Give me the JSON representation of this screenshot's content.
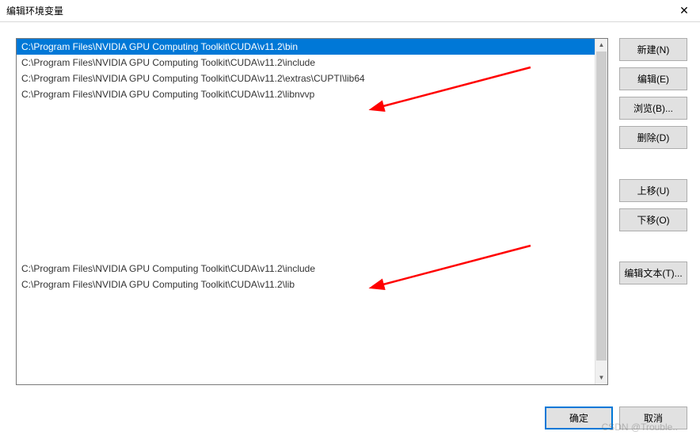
{
  "titlebar": {
    "title": "编辑环境变量",
    "close_label": "✕"
  },
  "list": {
    "items": [
      {
        "text": "C:\\Program Files\\NVIDIA GPU Computing Toolkit\\CUDA\\v11.2\\bin",
        "selected": true
      },
      {
        "text": "C:\\Program Files\\NVIDIA GPU Computing Toolkit\\CUDA\\v11.2\\include"
      },
      {
        "text": "C:\\Program Files\\NVIDIA GPU Computing Toolkit\\CUDA\\v11.2\\extras\\CUPTI\\lib64"
      },
      {
        "text": "C:\\Program Files\\NVIDIA GPU Computing Toolkit\\CUDA\\v11.2\\libnvvp"
      },
      {
        "text": " ",
        "blurred": true
      },
      {
        "text": " ",
        "blurred": true
      },
      {
        "text": " ",
        "blurred": true
      },
      {
        "text": " ",
        "blurred": true
      },
      {
        "text": " ",
        "blurred": true
      },
      {
        "text": " ",
        "blurred": true
      },
      {
        "text": " ",
        "blurred": true
      },
      {
        "text": " ",
        "blurred": true
      },
      {
        "text": " ",
        "blurred": true
      },
      {
        "text": " ",
        "blurred": true
      },
      {
        "text": "C:\\Program Files\\NVIDIA GPU Computing Toolkit\\CUDA\\v11.2\\include"
      },
      {
        "text": "C:\\Program Files\\NVIDIA GPU Computing Toolkit\\CUDA\\v11.2\\lib"
      },
      {
        "text": " ",
        "blurred": true
      },
      {
        "text": " ",
        "blurred": true
      },
      {
        "text": " ",
        "blurred": true
      },
      {
        "text": " ",
        "blurred": true
      },
      {
        "text": " ",
        "blurred": true
      }
    ]
  },
  "buttons": {
    "new": "新建(N)",
    "edit": "编辑(E)",
    "browse": "浏览(B)...",
    "delete": "删除(D)",
    "move_up": "上移(U)",
    "move_down": "下移(O)",
    "edit_text": "编辑文本(T)..."
  },
  "footer": {
    "ok": "确定",
    "cancel": "取消"
  },
  "watermark": "CSDN @Trouble..",
  "arrow_color": "#ff0000"
}
